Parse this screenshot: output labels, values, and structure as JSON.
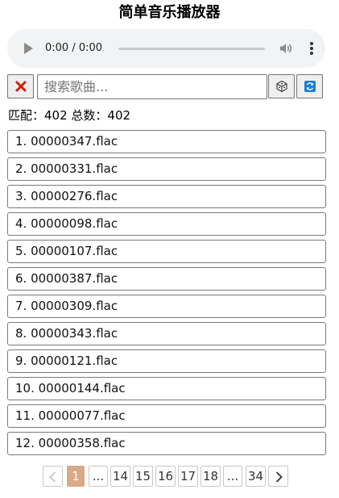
{
  "app": {
    "title": "简单音乐播放器"
  },
  "player": {
    "time": "0:00 / 0:00",
    "progress": 0,
    "icons": {
      "play": "play-icon",
      "volume": "volume-icon",
      "more": "more-vert-icon"
    }
  },
  "search": {
    "value": "",
    "placeholder": "搜索歌曲...",
    "icons": {
      "clear": "close-icon",
      "random": "dice-icon",
      "refresh": "refresh-icon"
    }
  },
  "status": {
    "text": "匹配：402 总数：402",
    "matched": 402,
    "total": 402
  },
  "songs": [
    "1. 00000347.flac",
    "2. 00000331.flac",
    "3. 00000276.flac",
    "4. 00000098.flac",
    "5. 00000107.flac",
    "6. 00000387.flac",
    "7. 00000309.flac",
    "8. 00000343.flac",
    "9. 00000121.flac",
    "10. 00000144.flac",
    "11. 00000077.flac",
    "12. 00000358.flac"
  ],
  "pagination": {
    "current": "1",
    "ellipsis": "...",
    "pages": [
      "14",
      "15",
      "16",
      "17",
      "18"
    ],
    "last": "34",
    "icons": {
      "prev": "chevron-left-icon",
      "next": "chevron-right-icon"
    }
  },
  "colors": {
    "active_page": "#d8aa86",
    "clear_icon": "#cc2200",
    "refresh_icon": "#1a7fd1"
  }
}
